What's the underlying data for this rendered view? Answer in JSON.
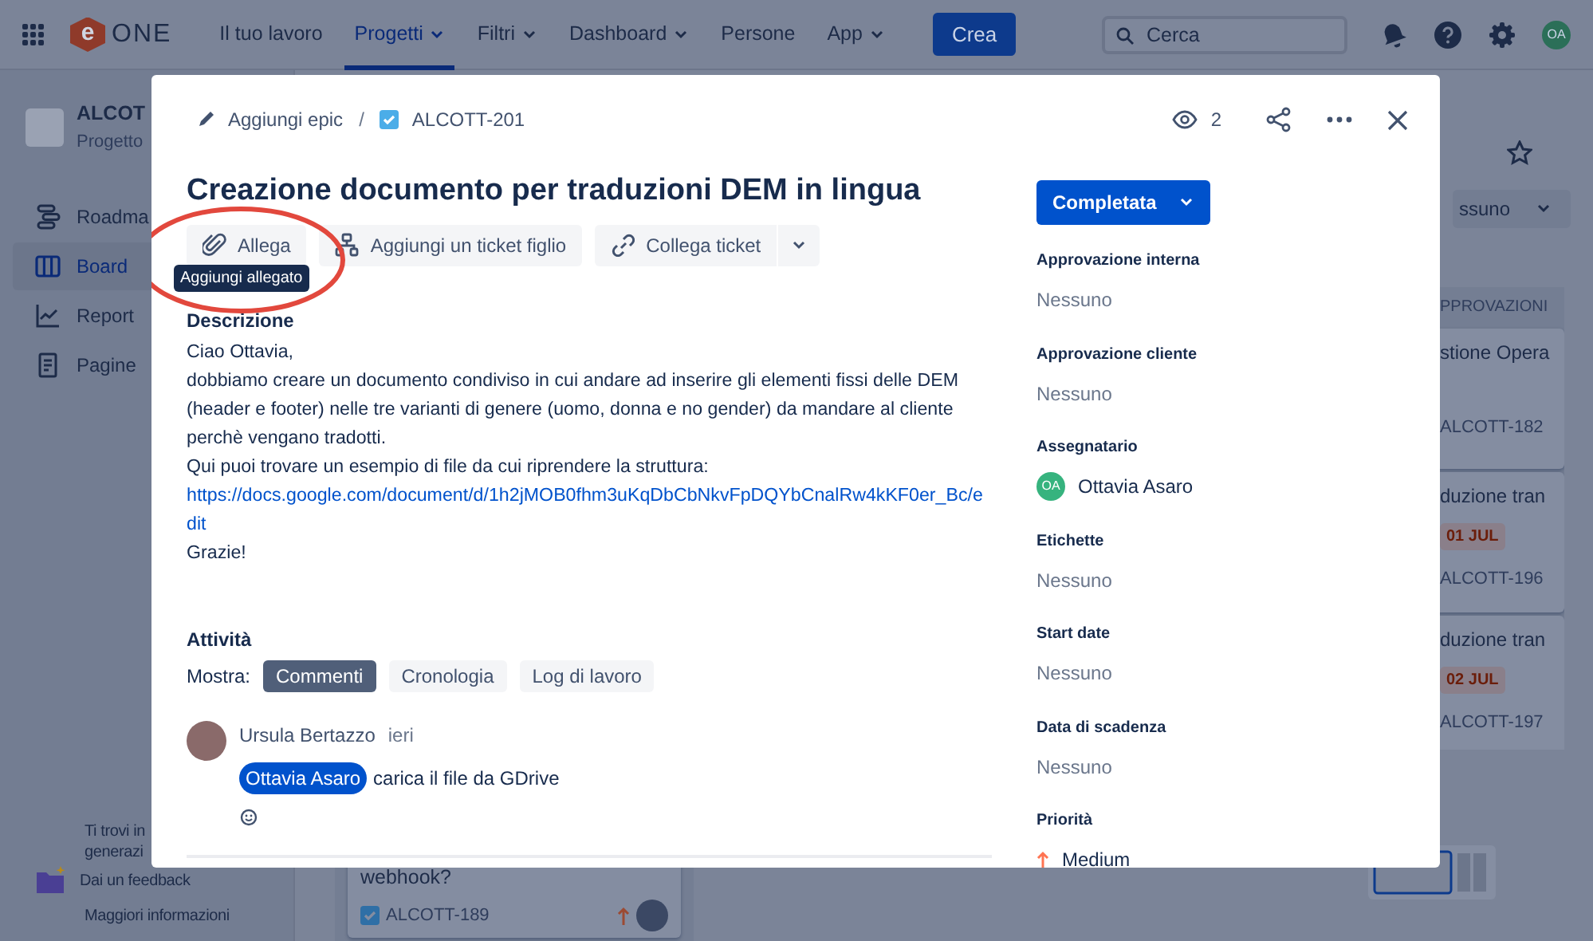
{
  "top_nav": {
    "logo": {
      "mark": "e",
      "text": "ONE"
    },
    "items": [
      {
        "label": "Il tuo lavoro",
        "selected": false,
        "dropdown": false
      },
      {
        "label": "Progetti",
        "selected": true,
        "dropdown": true
      },
      {
        "label": "Filtri",
        "selected": false,
        "dropdown": true
      },
      {
        "label": "Dashboard",
        "selected": false,
        "dropdown": true
      },
      {
        "label": "Persone",
        "selected": false,
        "dropdown": false
      },
      {
        "label": "App",
        "selected": false,
        "dropdown": true
      }
    ],
    "create_button": "Crea",
    "search": {
      "placeholder": "Cerca"
    },
    "avatar": "OA"
  },
  "sidebar": {
    "project_name": "ALCOT",
    "project_type": "Progetto",
    "items": [
      {
        "label": "Roadma",
        "selected": false
      },
      {
        "label": "Board",
        "selected": true
      },
      {
        "label": "Report",
        "selected": false
      },
      {
        "label": "Pagine",
        "selected": false
      }
    ],
    "footer": {
      "lines": [
        "Ti trovi in",
        "generazi"
      ],
      "feedback": "Dai un feedback",
      "more_info": "Maggiori informazioni"
    }
  },
  "board": {
    "filter": "ssuno",
    "column_header": "PPROVAZIONI",
    "cards": [
      {
        "title": "stione Opera",
        "key": "ALCOTT-182"
      },
      {
        "title": "duzione tran",
        "due": "01 JUL",
        "key": "ALCOTT-196"
      },
      {
        "title": "duzione tran",
        "due": "02 JUL",
        "key": "ALCOTT-197"
      }
    ],
    "bottom_card": {
      "title": "webhook?",
      "key": "ALCOTT-189"
    }
  },
  "modal": {
    "breadcrumb": {
      "epic": "Aggiungi epic",
      "separator": "/",
      "key": "ALCOTT-201"
    },
    "watchers": "2",
    "title": "Creazione documento per traduzioni DEM in lingua",
    "actions": [
      {
        "label": "Allega"
      },
      {
        "label": "Aggiungi un ticket figlio"
      },
      {
        "label": "Collega ticket"
      }
    ],
    "tooltip": "Aggiungi allegato",
    "description": {
      "heading": "Descrizione",
      "paragraphs": [
        {
          "kind": "text",
          "text": "Ciao Ottavia,"
        },
        {
          "kind": "text",
          "text": "dobbiamo creare un documento condiviso in cui andare ad inserire gli elementi fissi delle DEM (header e footer) nelle tre varianti di genere (uomo, donna e no gender) da mandare al cliente perchè vengano tradotti."
        },
        {
          "kind": "text",
          "text": "Qui puoi trovare un esempio di file da cui riprendere la struttura:"
        },
        {
          "kind": "link",
          "text": "https://docs.google.com/document/d/1h2jMOB0fhm3uKqDbCbNkvFpDQYbCnalRw4kKF0er_Bc/edit"
        },
        {
          "kind": "text",
          "text": "Grazie!"
        }
      ]
    },
    "activity": {
      "heading": "Attività",
      "show_label": "Mostra:",
      "filters": [
        {
          "label": "Commenti",
          "selected": true
        },
        {
          "label": "Cronologia",
          "selected": false
        },
        {
          "label": "Log di lavoro",
          "selected": false
        }
      ],
      "comment": {
        "author": "Ursula Bertazzo",
        "time": "ieri",
        "mention": "Ottavia Asaro",
        "text": "carica il file da GDrive"
      }
    },
    "status": "Completata",
    "fields": [
      {
        "label": "Approvazione interna",
        "kind": "empty",
        "value": "Nessuno"
      },
      {
        "label": "Approvazione cliente",
        "kind": "empty",
        "value": "Nessuno"
      },
      {
        "label": "Assegnatario",
        "kind": "user",
        "value": "Ottavia Asaro",
        "avatar": "OA"
      },
      {
        "label": "Etichette",
        "kind": "empty",
        "value": "Nessuno"
      },
      {
        "label": "Start date",
        "kind": "empty",
        "value": "Nessuno"
      },
      {
        "label": "Data di scadenza",
        "kind": "empty",
        "value": "Nessuno"
      },
      {
        "label": "Priorità",
        "kind": "priority",
        "value": "Medium"
      }
    ]
  }
}
